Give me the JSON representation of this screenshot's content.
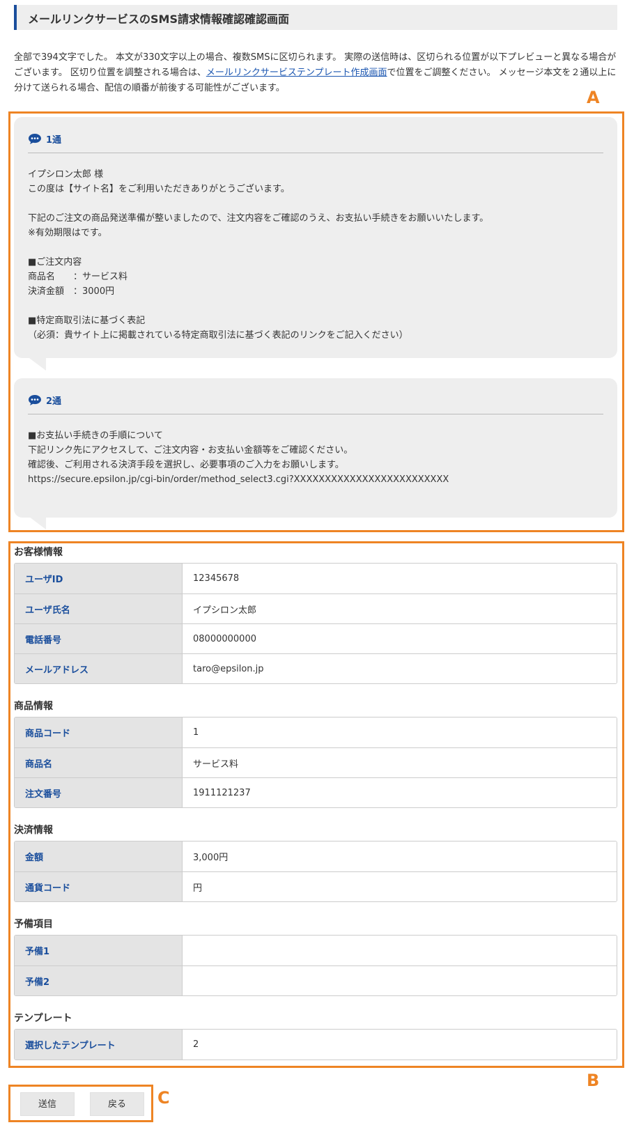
{
  "page_title": "メールリンクサービスのSMS請求情報確認確認画面",
  "intro": {
    "text_before_link": "全部で394文字でした。 本文が330文字以上の場合、複数SMSに区切られます。 実際の送信時は、区切られる位置が以下プレビューと異なる場合がございます。 区切り位置を調整される場合は、",
    "link_text": "メールリンクサービステンプレート作成画面",
    "text_after_link": "で位置をご調整ください。 メッセージ本文を２通以上に分けて送られる場合、配信の順番が前後する可能性がございます。"
  },
  "annotations": {
    "a": "A",
    "b": "B",
    "c": "C"
  },
  "accent_colors": {
    "frame": "#ee8424",
    "label": "#1a4e9c",
    "link": "#1a55b0"
  },
  "messages": [
    {
      "icon": "speech-bubble-icon",
      "label": "1通",
      "body": "イプシロン太郎 様\nこの度は【サイト名】をご利用いただきありがとうございます。\n\n下記のご注文の商品発送準備が整いましたので、注文内容をご確認のうえ、お支払い手続きをお願いいたします。\n※有効期限はです。\n\n■ご注文内容\n商品名　　：サービス料\n決済金額　：3000円\n\n■特定商取引法に基づく表記\n（必須：貴サイト上に掲載されている特定商取引法に基づく表記のリンクをご記入ください）"
    },
    {
      "icon": "speech-bubble-icon",
      "label": "2通",
      "body": "■お支払い手続きの手順について\n下記リンク先にアクセスして、ご注文内容・お支払い金額等をご確認ください。\n確認後、ご利用される決済手段を選択し、必要事項のご入力をお願いします。\nhttps://secure.epsilon.jp/cgi-bin/order/method_select3.cgi?XXXXXXXXXXXXXXXXXXXXXXXXX"
    }
  ],
  "sections": {
    "customer": {
      "title": "お客様情報",
      "rows": [
        {
          "label": "ユーザID",
          "value": "12345678"
        },
        {
          "label": "ユーザ氏名",
          "value": "イプシロン太郎"
        },
        {
          "label": "電話番号",
          "value": "08000000000"
        },
        {
          "label": "メールアドレス",
          "value": "taro@epsilon.jp"
        }
      ]
    },
    "product": {
      "title": "商品情報",
      "rows": [
        {
          "label": "商品コード",
          "value": "1"
        },
        {
          "label": "商品名",
          "value": "サービス料"
        },
        {
          "label": "注文番号",
          "value": "1911121237"
        }
      ]
    },
    "payment": {
      "title": "決済情報",
      "rows": [
        {
          "label": "金額",
          "value": "3,000円"
        },
        {
          "label": "通貨コード",
          "value": "円"
        }
      ]
    },
    "reserve": {
      "title": "予備項目",
      "rows": [
        {
          "label": "予備1",
          "value": ""
        },
        {
          "label": "予備2",
          "value": ""
        }
      ]
    },
    "template": {
      "title": "テンプレート",
      "rows": [
        {
          "label": "選択したテンプレート",
          "value": "2"
        }
      ]
    }
  },
  "buttons": {
    "send": "送信",
    "back": "戻る"
  }
}
